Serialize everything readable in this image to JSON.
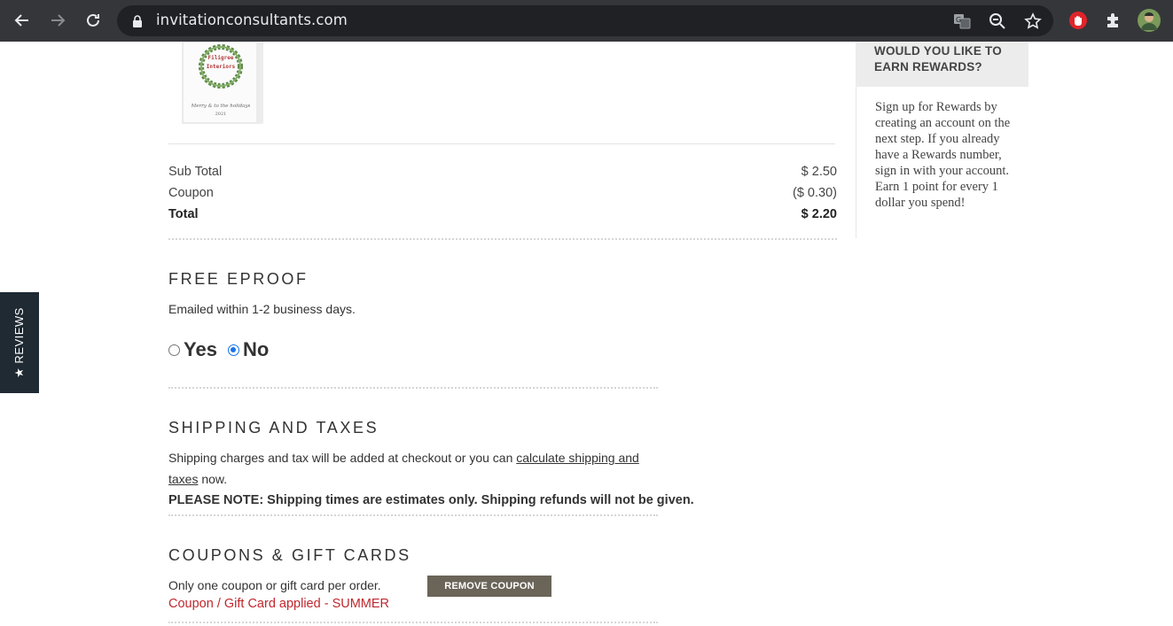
{
  "browser": {
    "url": "invitationconsultants.com"
  },
  "reviews_tab": {
    "label": "★ REVIEWS"
  },
  "order_summary": {
    "subtotal_label": "Sub Total",
    "subtotal_value": "$ 2.50",
    "coupon_label": "Coupon",
    "coupon_value": "($ 0.30)",
    "total_label": "Total",
    "total_value": "$ 2.20"
  },
  "eproof": {
    "title": "FREE EPROOF",
    "description": "Emailed within 1-2 business days.",
    "option_yes": "Yes",
    "option_no": "No",
    "selected": "No"
  },
  "shipping": {
    "title": "SHIPPING AND TAXES",
    "text_before": "Shipping charges and tax will be added at checkout or you can ",
    "link_text": "calculate shipping and taxes",
    "text_after": " now.",
    "note_label": "PLEASE NOTE:",
    "note_text": " Shipping times are estimates only. Shipping refunds will not be given."
  },
  "coupons": {
    "title": "COUPONS & GIFT CARDS",
    "description": "Only one coupon or gift card per order.",
    "remove_button": "REMOVE COUPON",
    "applied_text": "Coupon / Gift Card applied - SUMMER"
  },
  "rewards": {
    "heading": "WOULD YOU LIKE TO EARN REWARDS?",
    "body": "Sign up for Rewards by creating an account on the next step. If you already have a Rewards number, sign in with your account. Earn 1 point for every 1 dollar you spend!"
  },
  "product_thumb": {
    "card_title_line1": "Filigree",
    "card_title_line2": "Interiors",
    "card_script": "Merry & to the holidays",
    "card_year": "2021"
  },
  "colors": {
    "chrome_bg": "#35363a",
    "omnibox_bg": "#202124",
    "button_bg": "#6b6458",
    "applied_red": "#c0272d",
    "radio_blue": "#1a73e8",
    "reviews_bg": "#1f2a33"
  }
}
